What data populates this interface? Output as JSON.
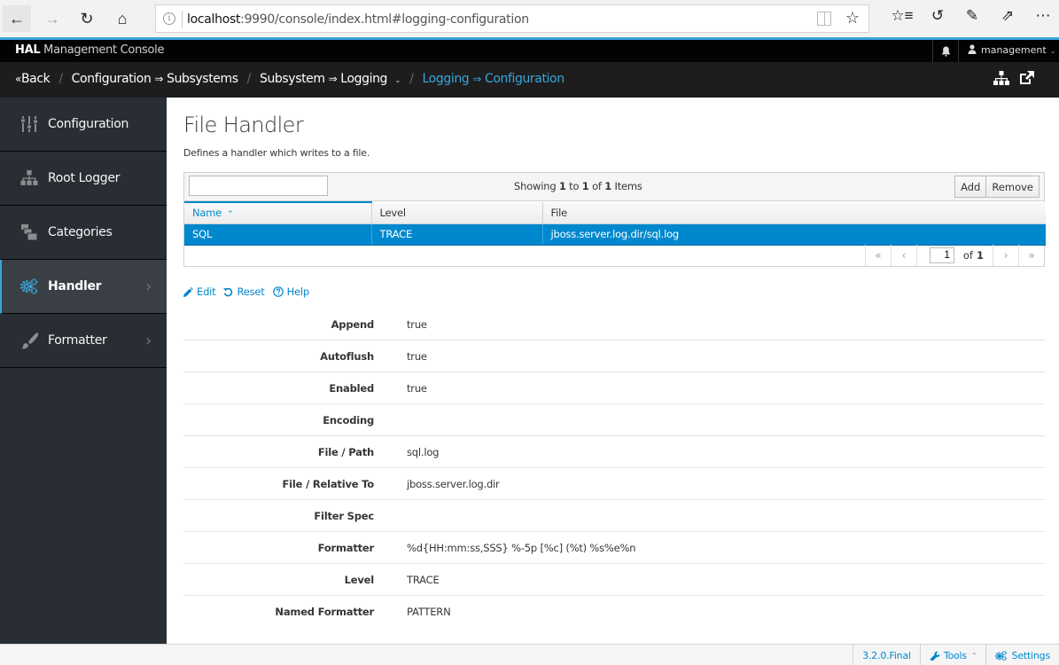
{
  "browser": {
    "url_host": "localhost",
    "url_rest": ":9990/console/index.html#logging-configuration",
    "icons": [
      "back-arrow-icon",
      "forward-arrow-icon",
      "refresh-icon",
      "home-icon",
      "info-icon",
      "reading-view-icon",
      "favorite-star-icon",
      "favorites-list-icon",
      "history-icon",
      "pen-icon",
      "share-icon",
      "more-icon"
    ]
  },
  "topnav": {
    "brand_bold": "HAL",
    "brand_rest": "Management Console",
    "user": "management"
  },
  "breadcrumb": {
    "back": "Back",
    "items": [
      {
        "a": "Configuration",
        "b": "Subsystems"
      },
      {
        "a": "Subsystem",
        "b": "Logging"
      },
      {
        "a": "Logging",
        "b": "Configuration"
      }
    ],
    "arrow": "⇒"
  },
  "sidebar": {
    "items": [
      {
        "label": "Configuration",
        "icon": "sliders-icon",
        "active": false,
        "has_children": false
      },
      {
        "label": "Root Logger",
        "icon": "sitemap-icon",
        "active": false,
        "has_children": false
      },
      {
        "label": "Categories",
        "icon": "folders-icon",
        "active": false,
        "has_children": false
      },
      {
        "label": "Handler",
        "icon": "cogs-icon",
        "active": true,
        "has_children": true
      },
      {
        "label": "Formatter",
        "icon": "paintbrush-icon",
        "active": false,
        "has_children": true
      }
    ]
  },
  "main": {
    "title": "File Handler",
    "description": "Defines a handler which writes to a file.",
    "table": {
      "filter_value": "",
      "showing_prefix": "Showing",
      "from": "1",
      "to_word": "to",
      "to": "1",
      "of_word": "of",
      "total": "1",
      "items_word": "Items",
      "add_label": "Add",
      "remove_label": "Remove",
      "columns": [
        "Name",
        "Level",
        "File"
      ],
      "sort_column": "Name",
      "rows": [
        {
          "name": "SQL",
          "level": "TRACE",
          "file": "jboss.server.log.dir/sql.log",
          "selected": true
        }
      ],
      "pager": {
        "page": "1",
        "of_word": "of",
        "pages": "1"
      }
    },
    "actions": {
      "edit": "Edit",
      "reset": "Reset",
      "help": "Help"
    },
    "attributes": [
      {
        "key": "Append",
        "value": "true"
      },
      {
        "key": "Autoflush",
        "value": "true"
      },
      {
        "key": "Enabled",
        "value": "true"
      },
      {
        "key": "Encoding",
        "value": ""
      },
      {
        "key": "File / Path",
        "value": "sql.log"
      },
      {
        "key": "File / Relative To",
        "value": "jboss.server.log.dir"
      },
      {
        "key": "Filter Spec",
        "value": ""
      },
      {
        "key": "Formatter",
        "value": "%d{HH:mm:ss,SSS} %-5p [%c] (%t) %s%e%n"
      },
      {
        "key": "Level",
        "value": "TRACE"
      },
      {
        "key": "Named Formatter",
        "value": "PATTERN"
      }
    ]
  },
  "footer": {
    "version": "3.2.0.Final",
    "tools": "Tools",
    "settings": "Settings"
  },
  "colors": {
    "accent": "#39a5dc",
    "selection": "#0088ce",
    "sidebar_bg": "#292e34",
    "sidebar_active_bg": "#393f44"
  }
}
